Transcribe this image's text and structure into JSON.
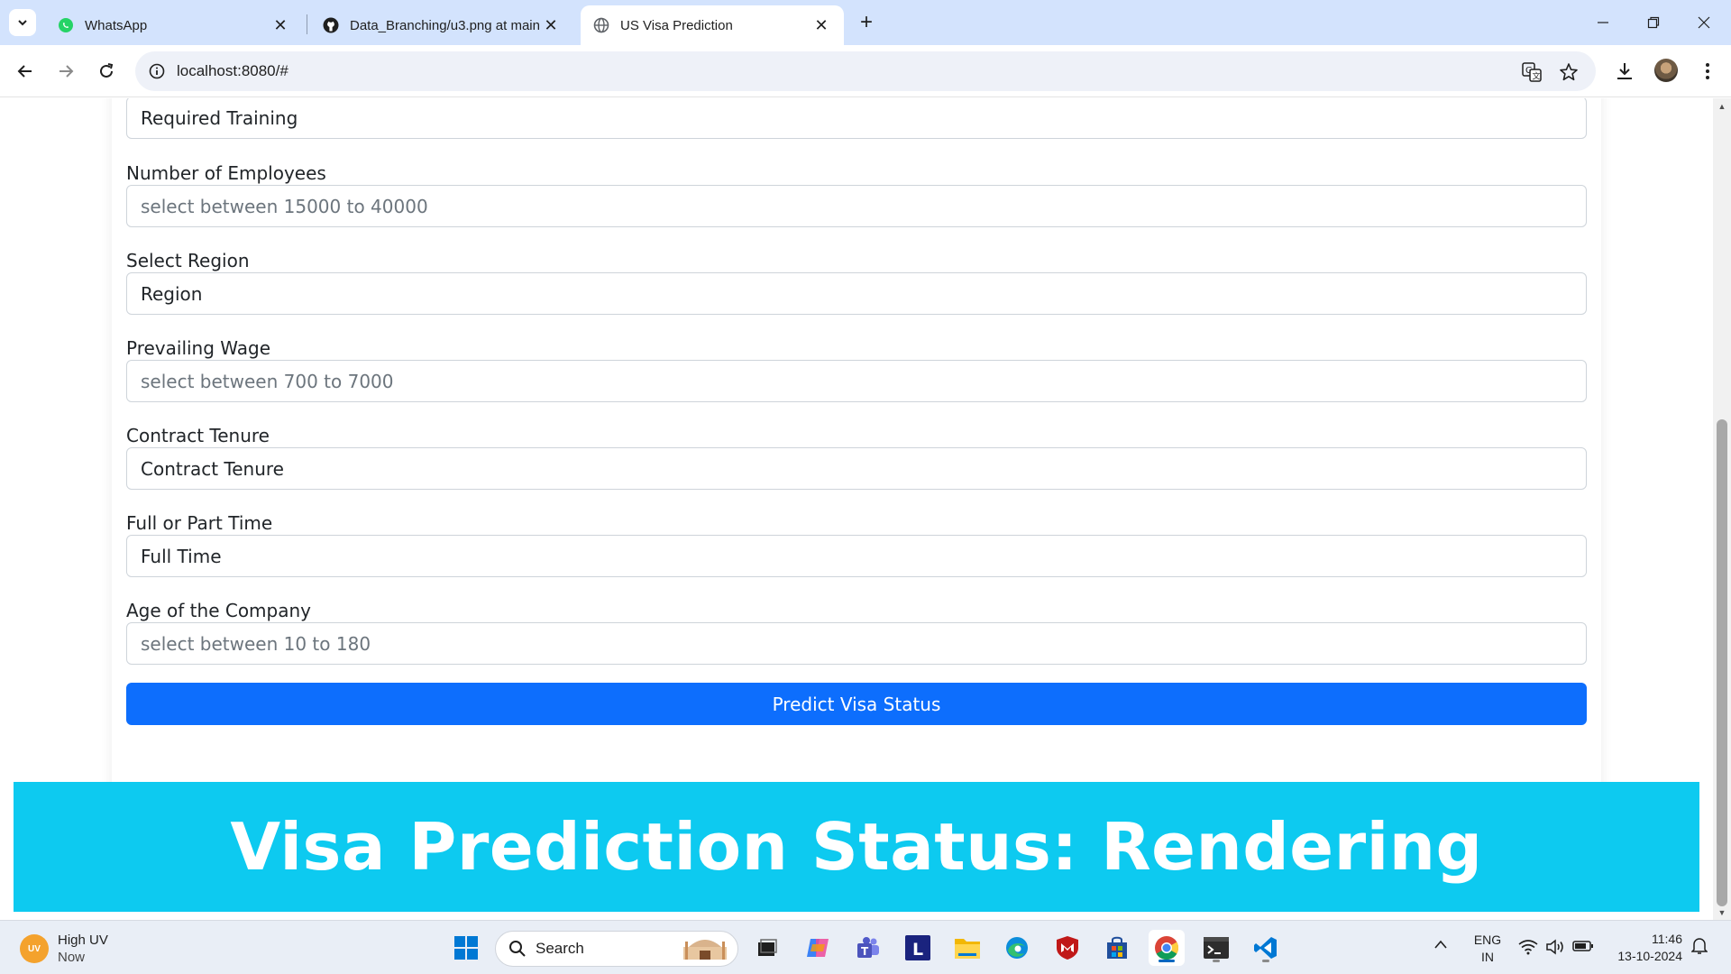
{
  "browser": {
    "tabs": [
      {
        "title": "WhatsApp",
        "icon": "whatsapp-icon",
        "active": false
      },
      {
        "title": "Data_Branching/u3.png at main",
        "icon": "github-icon",
        "active": false
      },
      {
        "title": "US Visa Prediction",
        "icon": "globe-icon",
        "active": true
      }
    ],
    "url": "localhost:8080/#"
  },
  "form": {
    "fields": [
      {
        "type": "select",
        "label": "",
        "value": "Required Training"
      },
      {
        "type": "input",
        "label": "Number of Employees",
        "value": "",
        "placeholder": "select between 15000 to 40000"
      },
      {
        "type": "select",
        "label": "Select Region",
        "value": "Region"
      },
      {
        "type": "input",
        "label": "Prevailing Wage",
        "value": "",
        "placeholder": "select between 700 to 7000"
      },
      {
        "type": "select",
        "label": "Contract Tenure",
        "value": "Contract Tenure"
      },
      {
        "type": "select",
        "label": "Full or Part Time",
        "value": "Full Time"
      },
      {
        "type": "input",
        "label": "Age of the Company",
        "value": "",
        "placeholder": "select between 10 to 180"
      }
    ],
    "submit_label": "Predict Visa Status"
  },
  "status_banner": {
    "text": "Visa Prediction Status: Rendering",
    "color": "#0dcaf0"
  },
  "colors": {
    "primary_button": "#0d6efd",
    "tab_strip": "#d3e3fd",
    "taskbar": "#e9eef6"
  },
  "taskbar": {
    "weather": {
      "title": "High UV",
      "subtitle": "Now",
      "badge": "UV"
    },
    "search_label": "Search",
    "apps": [
      "windows-start-icon",
      "search-icon",
      "task-view-icon",
      "copilot-icon",
      "teams-icon",
      "l-app-icon",
      "file-explorer-icon",
      "edge-icon",
      "mcafee-icon",
      "store-icon",
      "chrome-icon",
      "terminal-icon",
      "vscode-icon"
    ],
    "tray": {
      "language": "ENG",
      "region": "IN"
    },
    "clock": {
      "time": "11:46",
      "date": "13-10-2024"
    }
  }
}
